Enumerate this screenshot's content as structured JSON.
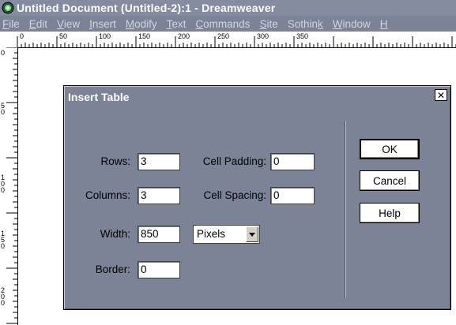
{
  "window": {
    "title": "Untitled Document (Untitled-2):1 - Dreamweaver",
    "app_icon": "dreamweaver-app-icon"
  },
  "menu": {
    "items": [
      {
        "label": "File",
        "mnemonic": "F",
        "rest": "ile"
      },
      {
        "label": "Edit",
        "mnemonic": "E",
        "rest": "dit"
      },
      {
        "label": "View",
        "mnemonic": "V",
        "rest": "iew"
      },
      {
        "label": "Insert",
        "mnemonic": "I",
        "rest": "nsert"
      },
      {
        "label": "Modify",
        "mnemonic": "M",
        "rest": "odify"
      },
      {
        "label": "Text",
        "mnemonic": "T",
        "rest": "ext"
      },
      {
        "label": "Commands",
        "mnemonic": "C",
        "rest": "ommands"
      },
      {
        "label": "Site",
        "mnemonic": "S",
        "rest": "ite"
      },
      {
        "label": "Sothink",
        "pre": "Sothin",
        "mnemonic": "k",
        "rest": ""
      },
      {
        "label": "Window",
        "mnemonic": "W",
        "rest": "indow"
      },
      {
        "label": "H",
        "mnemonic": "H",
        "rest": ""
      }
    ]
  },
  "ruler": {
    "horizontal_labels": [
      "0",
      "50",
      "100",
      "150",
      "200",
      "250",
      "300",
      "350"
    ],
    "vertical_labels": [
      "0",
      "50",
      "100",
      "150",
      "200"
    ]
  },
  "dialog": {
    "title": "Insert Table",
    "close_icon": "close-icon",
    "rows_label": "Rows:",
    "rows_value": "3",
    "columns_label": "Columns:",
    "columns_value": "3",
    "width_label": "Width:",
    "width_value": "850",
    "border_label": "Border:",
    "border_value": "0",
    "cell_padding_label": "Cell Padding:",
    "cell_padding_value": "0",
    "cell_spacing_label": "Cell Spacing:",
    "cell_spacing_value": "0",
    "width_unit": "Pixels",
    "ok_label": "OK",
    "cancel_label": "Cancel",
    "help_label": "Help"
  },
  "colors": {
    "title_bar": "#858ba0",
    "menu_bar": "#7c8397",
    "dialog_bg": "#7c8397"
  }
}
